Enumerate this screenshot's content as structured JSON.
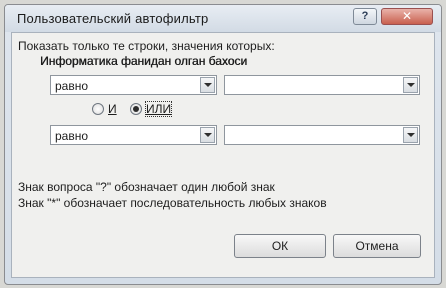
{
  "window": {
    "title": "Пользовательский автофильтр",
    "help_label": "?",
    "close_label": "✕"
  },
  "dialog": {
    "instruction": "Показать только те строки, значения которых:",
    "field_name": "Информатика фанидан олган бахоси",
    "condition1": {
      "operator": "равно",
      "value": ""
    },
    "logic": {
      "and_label": "И",
      "or_label": "ИЛИ",
      "selected": "ИЛИ"
    },
    "condition2": {
      "operator": "равно",
      "value": ""
    },
    "hint1": "Знак вопроса \"?\" обозначает один любой знак",
    "hint2": "Знак \"*\" обозначает последовательность любых знаков"
  },
  "buttons": {
    "ok": "ОК",
    "cancel": "Отмена"
  }
}
